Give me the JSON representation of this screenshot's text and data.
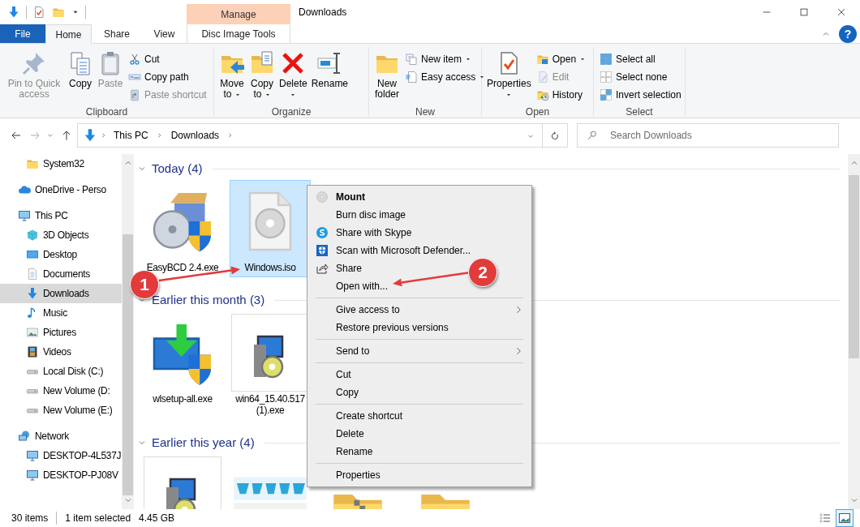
{
  "window": {
    "title": "Downloads",
    "contextual_header": "Manage",
    "help": "?"
  },
  "ribbon_tabs": [
    {
      "label": "File",
      "kind": "file",
      "selected": false
    },
    {
      "label": "Home",
      "kind": "tab",
      "selected": true
    },
    {
      "label": "Share",
      "kind": "tab",
      "selected": false
    },
    {
      "label": "View",
      "kind": "tab",
      "selected": false
    },
    {
      "label": "Disc Image Tools",
      "kind": "contextual",
      "selected": false
    }
  ],
  "ribbon_groups": [
    {
      "label": "Clipboard",
      "buttons": [
        {
          "label": "Pin to Quick access",
          "kind": "large",
          "disabled": true,
          "dropdown": false
        },
        {
          "label": "Copy",
          "kind": "large",
          "disabled": false,
          "dropdown": false
        },
        {
          "label": "Paste",
          "kind": "large",
          "disabled": true,
          "dropdown": false
        },
        {
          "label": "Cut",
          "kind": "small",
          "disabled": false,
          "dropdown": false
        },
        {
          "label": "Copy path",
          "kind": "small",
          "disabled": false,
          "dropdown": false
        },
        {
          "label": "Paste shortcut",
          "kind": "small",
          "disabled": true,
          "dropdown": false
        }
      ]
    },
    {
      "label": "Organize",
      "buttons": [
        {
          "label": "Move to",
          "kind": "large",
          "disabled": false,
          "dropdown": true
        },
        {
          "label": "Copy to",
          "kind": "large",
          "disabled": false,
          "dropdown": true
        },
        {
          "label": "Delete",
          "kind": "large",
          "disabled": false,
          "dropdown": true
        },
        {
          "label": "Rename",
          "kind": "large",
          "disabled": false,
          "dropdown": false
        }
      ]
    },
    {
      "label": "New",
      "buttons": [
        {
          "label": "New folder",
          "kind": "large",
          "disabled": false,
          "dropdown": false
        },
        {
          "label": "New item",
          "kind": "small",
          "disabled": false,
          "dropdown": true
        },
        {
          "label": "Easy access",
          "kind": "small",
          "disabled": false,
          "dropdown": true
        }
      ]
    },
    {
      "label": "Open",
      "buttons": [
        {
          "label": "Properties",
          "kind": "large",
          "disabled": false,
          "dropdown": true
        },
        {
          "label": "Open",
          "kind": "small",
          "disabled": false,
          "dropdown": true
        },
        {
          "label": "Edit",
          "kind": "small",
          "disabled": true,
          "dropdown": false
        },
        {
          "label": "History",
          "kind": "small",
          "disabled": false,
          "dropdown": false
        }
      ]
    },
    {
      "label": "Select",
      "buttons": [
        {
          "label": "Select all",
          "kind": "small",
          "disabled": false,
          "dropdown": false
        },
        {
          "label": "Select none",
          "kind": "small",
          "disabled": false,
          "dropdown": false
        },
        {
          "label": "Invert selection",
          "kind": "small",
          "disabled": false,
          "dropdown": false
        }
      ]
    }
  ],
  "address_bar": {
    "breadcrumbs": [
      "This PC",
      "Downloads"
    ]
  },
  "search": {
    "placeholder": "Search Downloads"
  },
  "sidebar": {
    "items": [
      {
        "children": [
          {
            "label": "System32",
            "selected": false
          }
        ]
      },
      {
        "label": "OneDrive - Perso",
        "selected": false
      },
      {
        "label": "This PC",
        "selected": false,
        "children": [
          {
            "label": "3D Objects",
            "selected": false
          },
          {
            "label": "Desktop",
            "selected": false
          },
          {
            "label": "Documents",
            "selected": false
          },
          {
            "label": "Downloads",
            "selected": true
          },
          {
            "label": "Music",
            "selected": false
          },
          {
            "label": "Pictures",
            "selected": false
          },
          {
            "label": "Videos",
            "selected": false
          },
          {
            "label": "Local Disk (C:)",
            "selected": false
          },
          {
            "label": "New Volume (D:",
            "selected": false
          },
          {
            "label": "New Volume (E:)",
            "selected": false
          }
        ]
      },
      {
        "label": "Network",
        "selected": false,
        "children": [
          {
            "label": "DESKTOP-4L537J",
            "selected": false
          },
          {
            "label": "DESKTOP-PJ08V",
            "selected": false
          }
        ]
      }
    ]
  },
  "groups": [
    {
      "title": "Today (4)",
      "expanded": true,
      "items": [
        {
          "label": "EasyBCD 2.4.exe",
          "selected": false,
          "framed": false
        },
        {
          "label": "Windows.iso",
          "selected": true,
          "framed": false
        }
      ]
    },
    {
      "title": "Earlier this month (3)",
      "expanded": true,
      "items": [
        {
          "label": "wlsetup-all.exe",
          "selected": false,
          "framed": false
        },
        {
          "label": "win64_15.40.517 (1).exe",
          "selected": false,
          "framed": true
        }
      ]
    },
    {
      "title": "Earlier this year (4)",
      "expanded": true,
      "items": [
        {
          "selected": false,
          "framed": true
        },
        {
          "selected": false,
          "framed": false,
          "kind": "picture"
        },
        {
          "selected": false,
          "framed": false
        },
        {
          "selected": false,
          "framed": false
        }
      ]
    }
  ],
  "context_menu": {
    "sections": [
      [
        {
          "label": "Mount",
          "default": true,
          "submenu": false
        },
        {
          "label": "Burn disc image",
          "default": false,
          "submenu": false
        },
        {
          "label": "Share with Skype",
          "default": false,
          "submenu": false
        },
        {
          "label": "Scan with Microsoft Defender...",
          "default": false,
          "submenu": false
        },
        {
          "label": "Share",
          "default": false,
          "submenu": false
        },
        {
          "label": "Open with...",
          "default": false,
          "submenu": false
        }
      ],
      [
        {
          "label": "Give access to",
          "default": false,
          "submenu": true
        },
        {
          "label": "Restore previous versions",
          "default": false,
          "submenu": false
        }
      ],
      [
        {
          "label": "Send to",
          "default": false,
          "submenu": true
        }
      ],
      [
        {
          "label": "Cut",
          "default": false,
          "submenu": false
        },
        {
          "label": "Copy",
          "default": false,
          "submenu": false
        }
      ],
      [
        {
          "label": "Create shortcut",
          "default": false,
          "submenu": false
        },
        {
          "label": "Delete",
          "default": false,
          "submenu": false
        },
        {
          "label": "Rename",
          "default": false,
          "submenu": false
        }
      ],
      [
        {
          "label": "Properties",
          "default": false,
          "submenu": false
        }
      ]
    ]
  },
  "annotations": [
    {
      "label": "1"
    },
    {
      "label": "2"
    }
  ],
  "status_bar": {
    "count": "30 items",
    "selection": "1 item selected",
    "size": "4.45 GB"
  },
  "view_buttons": [
    {
      "selected": false
    },
    {
      "selected": true
    }
  ]
}
